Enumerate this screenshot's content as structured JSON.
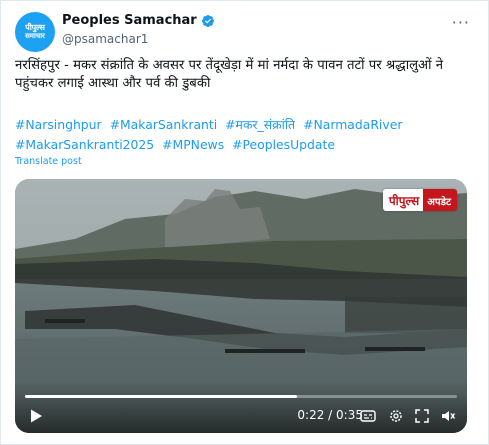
{
  "account": {
    "avatar_text_line1": "पीपुल्स",
    "avatar_text_line2": "समाचार",
    "display_name": "Peoples Samachar",
    "handle": "@psamachar1",
    "verified": true
  },
  "post": {
    "text": "नरसिंहपुर - मकर संक्रांति के अवसर पर तेंदूखेड़ा में मां नर्मदा के पावन तटों पर श्रद्धालुओं ने पहुंचकर लगाई आस्था और पर्व की डुबकी",
    "hashtags": [
      "#Narsinghpur",
      "#MakarSankranti",
      "#मकर_संक्रांति",
      "#NarmadaRiver",
      "#MakarSankranti2025",
      "#MPNews",
      "#PeoplesUpdate"
    ],
    "translate_label": "Translate post"
  },
  "video": {
    "watermark_part1": "पीपुल्स",
    "watermark_part2": "अपडेट",
    "current_time": "0:22",
    "duration": "0:35",
    "time_display": "0:22 / 0:35",
    "progress": 0.629
  },
  "colors": {
    "accent": "#1d9bf0",
    "verified": "#1d9bf0",
    "watermark_red": "#c4161c"
  },
  "icons": {
    "more": "more-icon",
    "play": "play-icon",
    "captions": "captions-icon",
    "settings": "settings-icon",
    "fullscreen": "fullscreen-icon",
    "volume": "volume-icon"
  }
}
